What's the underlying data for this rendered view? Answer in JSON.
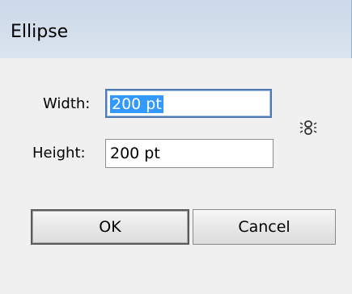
{
  "dialog": {
    "title": "Ellipse"
  },
  "width": {
    "label": "Width:",
    "value": "200 pt"
  },
  "height": {
    "label": "Height:",
    "value": "200 pt"
  },
  "constrain_icon": "chain-link-icon",
  "buttons": {
    "ok_label": "OK",
    "cancel_label": "Cancel"
  },
  "colors": {
    "title_bar": "#d4dfec",
    "background": "#f0f0f0",
    "focus_border": "#4f79b3",
    "selection": "#3399ff"
  }
}
